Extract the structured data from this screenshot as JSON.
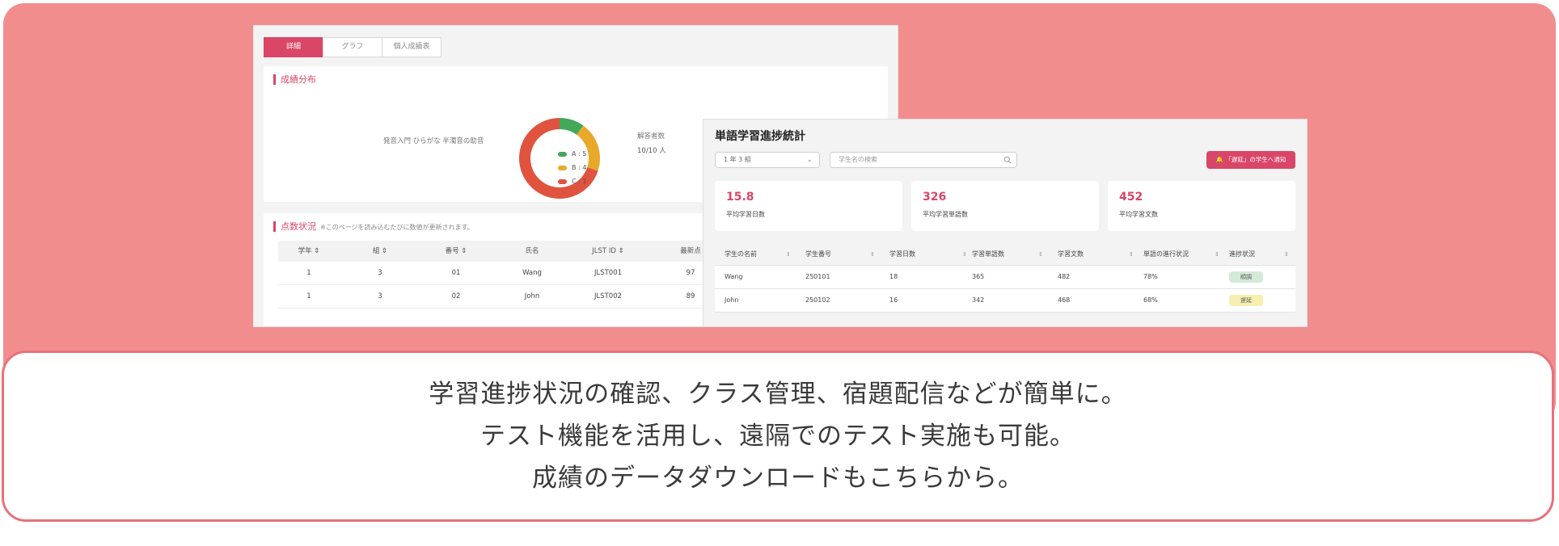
{
  "caption": {
    "lines": [
      "学習進捗状況の確認、クラス管理、宿題配信などが簡単に。",
      "テスト機能を活用し、遠隔でのテスト実施も可能。",
      "成績のデータダウンロードもこちらから。"
    ]
  },
  "screen_a": {
    "tabs": [
      "詳細",
      "グラフ",
      "個人成績表"
    ],
    "distribution": {
      "title": "成績分布",
      "caption": "発音入門 ひらがな 半濁音の助音",
      "respondents_label": "解答者数",
      "respondents_value": "10/10 人"
    },
    "scores": {
      "title": "点数状況",
      "note": "※このページを読み込むたびに数値が更新されます。",
      "headers": [
        "学年 ⇕",
        "組 ⇕",
        "番号 ⇕",
        "氏名",
        "JLST ID ⇕",
        "最新点"
      ],
      "rows": [
        [
          "1",
          "3",
          "01",
          "Wang",
          "JLST001",
          "97"
        ],
        [
          "1",
          "3",
          "02",
          "John",
          "JLST002",
          "89"
        ]
      ]
    }
  },
  "chart_data": {
    "type": "pie",
    "categories": [
      "A : 5",
      "B : 4",
      "C : 1"
    ],
    "values": [
      1,
      2,
      7
    ],
    "colors": [
      "#42a85a",
      "#e8a92b",
      "#e0533f"
    ]
  },
  "screen_b": {
    "title": "単語学習進捗統計",
    "grade_select": "1 年 3 組",
    "search_placeholder": "学生名の検索",
    "notify_button": "「遅延」の学生へ通知",
    "stats": [
      {
        "value": "15.8",
        "label": "平均学習日数"
      },
      {
        "value": "326",
        "label": "平均学習単語数"
      },
      {
        "value": "452",
        "label": "平均学習文数"
      }
    ],
    "table": {
      "headers": [
        "学生の名前",
        "学生番号",
        "学習日数",
        "学習単語数",
        "学習文数",
        "単語の進行状況",
        "進捗状況"
      ],
      "rows": [
        {
          "name": "Wang",
          "id": "250101",
          "days": "18",
          "words": "365",
          "sentences": "482",
          "progress": "78%",
          "status": "順調"
        },
        {
          "name": "John",
          "id": "250102",
          "days": "16",
          "words": "342",
          "sentences": "468",
          "progress": "68%",
          "status": "遅延"
        }
      ]
    }
  },
  "colors": {
    "accent": "#d94667",
    "panel": "#f28d8e",
    "badge_ok": "#d4ead9",
    "badge_late": "#f6efb0"
  }
}
